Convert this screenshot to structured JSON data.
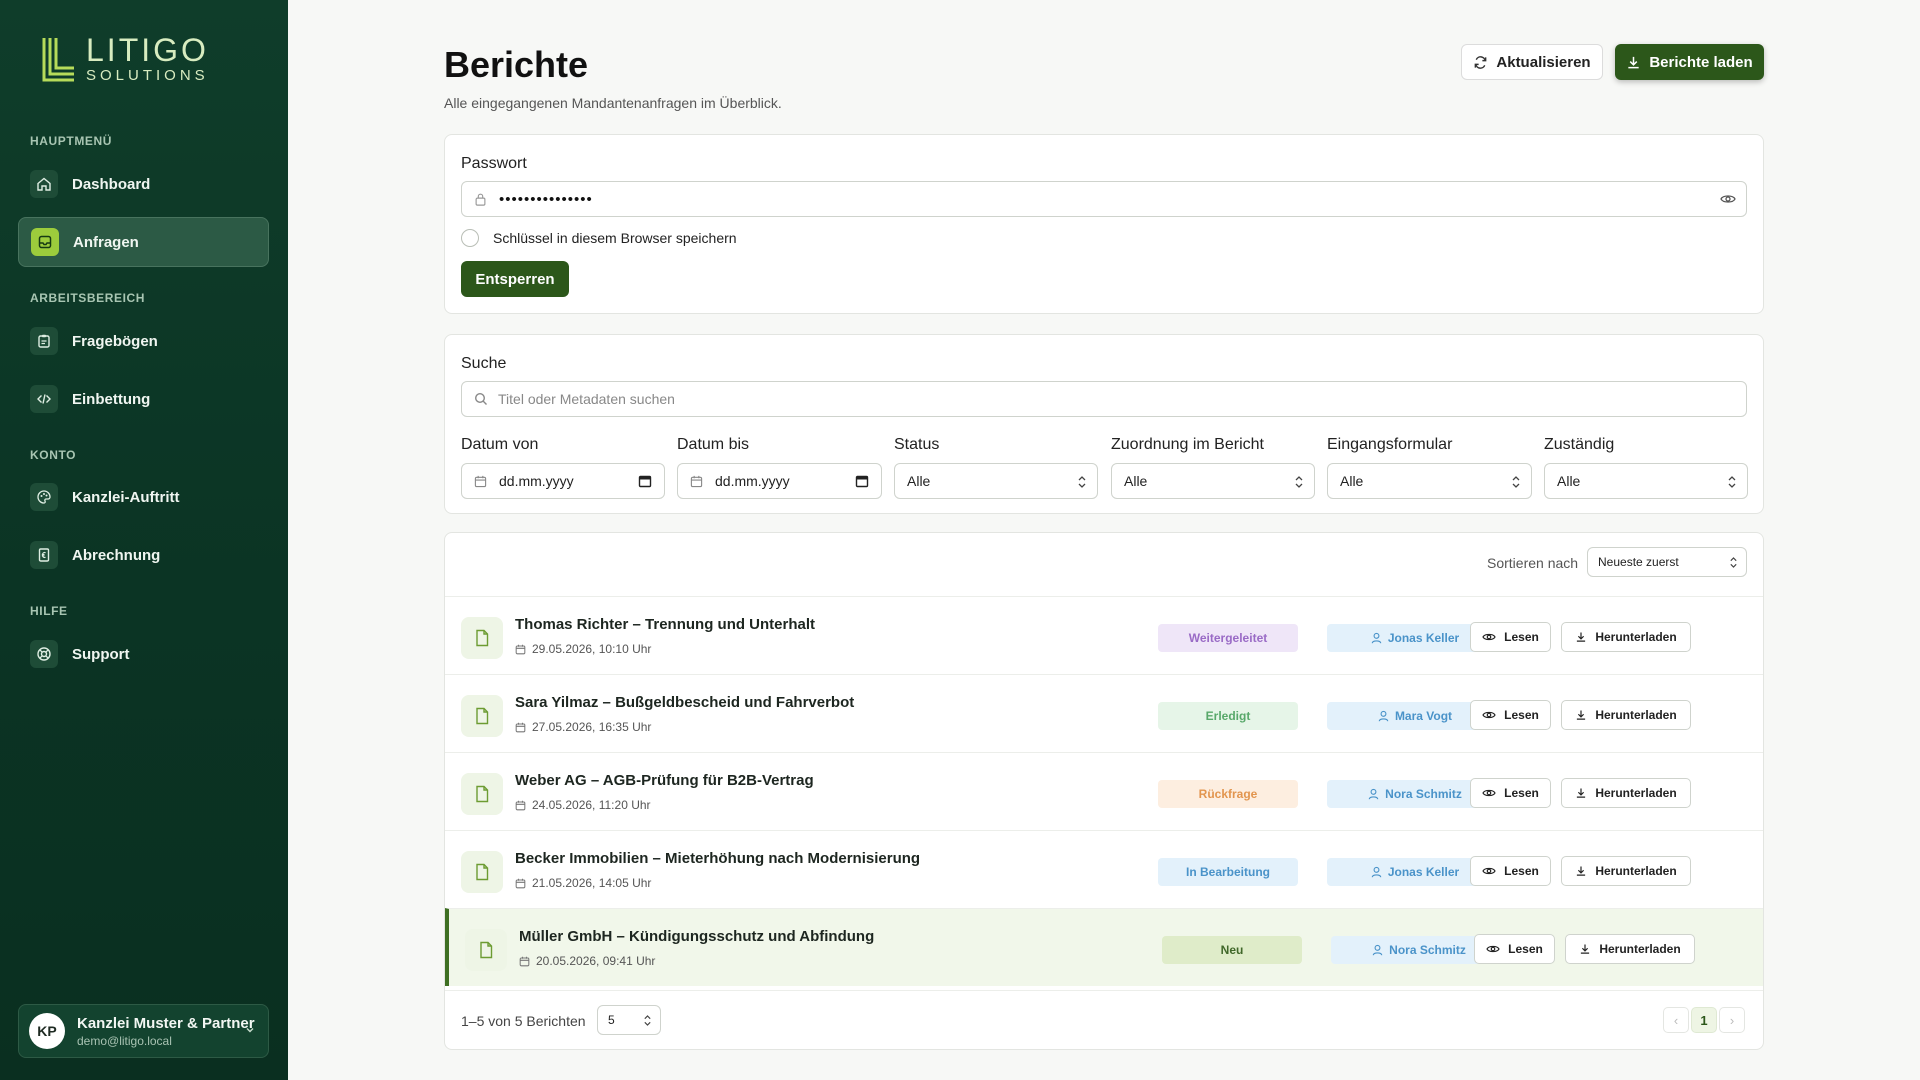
{
  "brand": {
    "name": "LITIGO",
    "tagline": "SOLUTIONS"
  },
  "sidebar": {
    "sections": [
      {
        "label": "HAUPTMENÜ"
      },
      {
        "label": "ARBEITSBEREICH"
      },
      {
        "label": "KONTO"
      },
      {
        "label": "HILFE"
      }
    ],
    "items": [
      {
        "label": "Dashboard",
        "icon": "home-icon"
      },
      {
        "label": "Anfragen",
        "icon": "inbox-icon",
        "active": true
      },
      {
        "label": "Fragebögen",
        "icon": "clipboard-icon"
      },
      {
        "label": "Einbettung",
        "icon": "code-icon"
      },
      {
        "label": "Kanzlei-Auftritt",
        "icon": "palette-icon"
      },
      {
        "label": "Abrechnung",
        "icon": "receipt-icon"
      },
      {
        "label": "Support",
        "icon": "lifebuoy-icon"
      }
    ],
    "account": {
      "initials": "KP",
      "name": "Kanzlei Muster & Partner",
      "email": "demo@litigo.local"
    }
  },
  "header": {
    "title": "Berichte",
    "subtitle": "Alle eingegangenen Mandantenanfragen im Überblick.",
    "refresh_label": "Aktualisieren",
    "load_label": "Berichte laden"
  },
  "unlock": {
    "password_label": "Passwort",
    "password_value": "•••••••••••••••",
    "remember_label": "Schlüssel in diesem Browser speichern",
    "unlock_label": "Entsperren"
  },
  "filters": {
    "search_label": "Suche",
    "search_placeholder": "Titel oder Metadaten suchen",
    "date_from_label": "Datum von",
    "date_from_value": "dd.mm.yyyy",
    "date_to_label": "Datum bis",
    "date_to_value": "dd.mm.yyyy",
    "status_label": "Status",
    "status_value": "Alle",
    "assignment_label": "Zuordnung im Bericht",
    "assignment_value": "Alle",
    "form_label": "Eingangsformular",
    "form_value": "Alle",
    "owner_label": "Zuständig",
    "owner_value": "Alle"
  },
  "list": {
    "sort_label": "Sortieren nach",
    "sort_value": "Neueste zuerst",
    "read_label": "Lesen",
    "download_label": "Herunterladen",
    "rows": [
      {
        "title": "Thomas Richter – Trennung und Unterhalt",
        "date": "29.05.2026, 10:10 Uhr",
        "status": "Weitergeleitet",
        "assignee": "Jonas Keller"
      },
      {
        "title": "Sara Yilmaz – Bußgeldbescheid und Fahrverbot",
        "date": "27.05.2026, 16:35 Uhr",
        "status": "Erledigt",
        "assignee": "Mara Vogt"
      },
      {
        "title": "Weber AG – AGB-Prüfung für B2B-Vertrag",
        "date": "24.05.2026, 11:20 Uhr",
        "status": "Rückfrage",
        "assignee": "Nora Schmitz"
      },
      {
        "title": "Becker Immobilien – Mieterhöhung nach Modernisierung",
        "date": "21.05.2026, 14:05 Uhr",
        "status": "In Bearbeitung",
        "assignee": "Jonas Keller"
      },
      {
        "title": "Müller GmbH – Kündigungsschutz und Abfindung",
        "date": "20.05.2026, 09:41 Uhr",
        "status": "Neu",
        "assignee": "Nora Schmitz"
      }
    ],
    "status_colors": {
      "Weitergeleitet": {
        "bg": "#efe6f8",
        "fg": "#9a6bc6"
      },
      "Erledigt": {
        "bg": "#e6f5e8",
        "fg": "#58a86a"
      },
      "Rückfrage": {
        "bg": "#fdeee0",
        "fg": "#e2954e"
      },
      "In Bearbeitung": {
        "bg": "#e3f1fb",
        "fg": "#4a93c9"
      },
      "Neu": {
        "bg": "#dfecc9",
        "fg": "#41682a"
      }
    },
    "footer": {
      "summary": "1–5 von 5 Berichten",
      "page_size": "5",
      "current_page": "1",
      "prev": "‹",
      "next": "›"
    }
  }
}
